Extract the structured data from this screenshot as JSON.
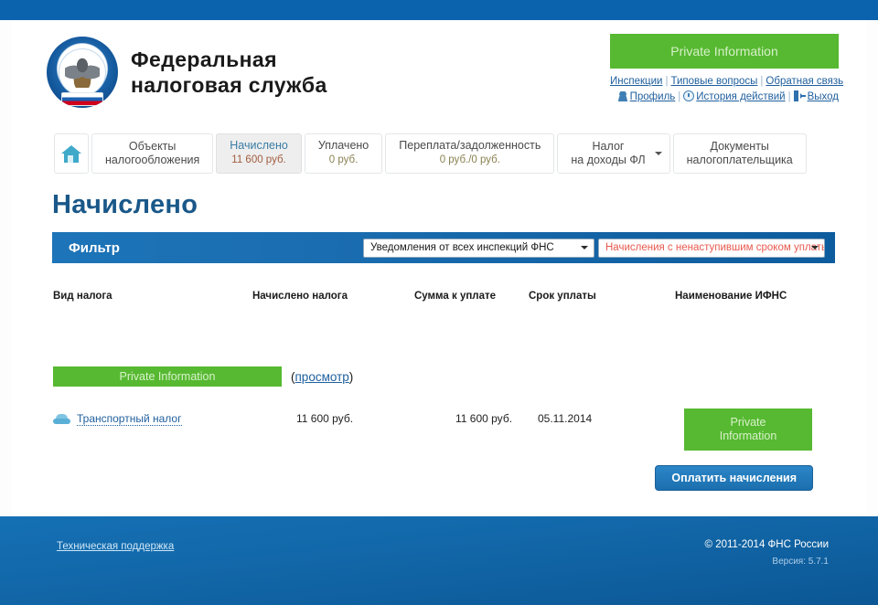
{
  "brand": {
    "title": "Федеральная\nналоговая служба",
    "emblem_icon": "fns-emblem-icon"
  },
  "account": {
    "private_badge": "Private Information",
    "links_row1": [
      {
        "label": "Инспекции"
      },
      {
        "label": "Типовые вопросы"
      },
      {
        "label": "Обратная связь"
      }
    ],
    "links_row2": [
      {
        "label": "Профиль",
        "icon": "user-icon"
      },
      {
        "label": "История действий",
        "icon": "clock-icon"
      },
      {
        "label": "Выход",
        "icon": "exit-icon"
      }
    ]
  },
  "tabs": {
    "home_icon": "home-icon",
    "items": [
      {
        "label": "Объекты\nналогообложения",
        "value": "",
        "active": false
      },
      {
        "label": "Начислено",
        "value": "11 600 руб.",
        "active": true
      },
      {
        "label": "Уплачено",
        "value": "0 руб.",
        "active": false
      },
      {
        "label": "Переплата/задолженность",
        "value": "0 руб./0 руб.",
        "active": false
      },
      {
        "label": "Налог\nна доходы ФЛ",
        "value": "",
        "active": false,
        "has_caret": true
      },
      {
        "label": "Документы\nналогоплательщика",
        "value": "",
        "active": false
      }
    ]
  },
  "page": {
    "title": "Начислено"
  },
  "filter": {
    "label": "Фильтр",
    "inspection_select": {
      "value": "Уведомления от всех инспекций ФНС",
      "caret_icon": "chevron-down-icon"
    },
    "charges_select": {
      "value": "Начисления с ненаступившим сроком уплаты",
      "caret_icon": "chevron-down-icon",
      "color": "#e8594e"
    }
  },
  "table": {
    "headers": [
      "Вид налога",
      "Начислено налога",
      "Сумма к уплате",
      "Срок уплаты",
      "Наименование ИФНС"
    ],
    "group": {
      "private_label": "Private Information",
      "view_open": "(",
      "view_link": "просмотр",
      "view_close": ")"
    },
    "rows": [
      {
        "icon": "car-icon",
        "tax_type": "Транспортный налог",
        "accrued": "11 600 руб.",
        "amount_due": "11 600 руб.",
        "due_date": "05.11.2014",
        "ifns": "Private\nInformation"
      }
    ]
  },
  "actions": {
    "pay_button": "Оплатить начисления"
  },
  "footer": {
    "support": "Техническая поддержка",
    "copyright": "© 2011-2014 ФНС России",
    "version": "Версия: 5.7.1"
  },
  "colors": {
    "header_blue": "#0b63ae",
    "accent_green": "#56b931",
    "filter_blue": "#1a6db0",
    "title_blue": "#1a5889",
    "link_blue": "#1f5f9e",
    "alert_red": "#e8594e"
  }
}
